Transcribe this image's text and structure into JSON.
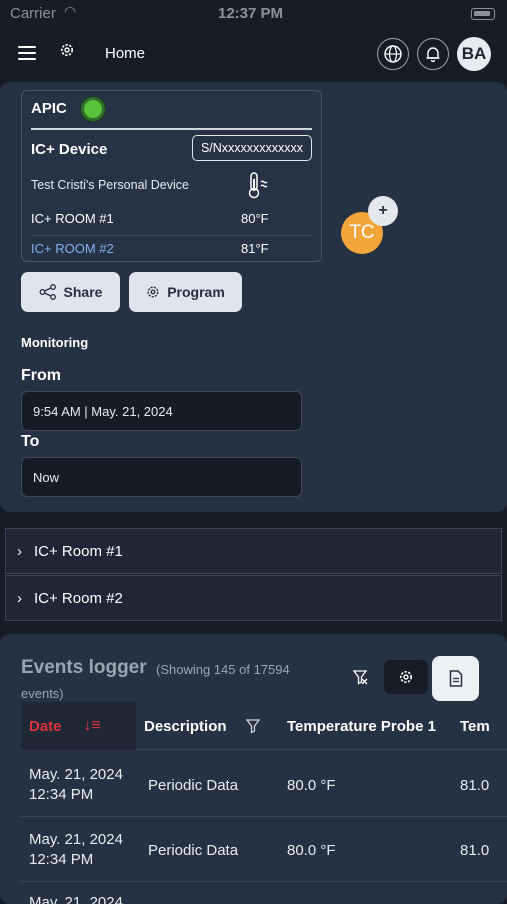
{
  "status_bar": {
    "carrier": "Carrier",
    "time": "12:37 PM"
  },
  "header": {
    "home_label": "Home",
    "avatar_initials": "BA"
  },
  "device": {
    "system_label": "APIC",
    "status_color": "#58c13a",
    "title": "IC+ Device",
    "serial": "S/Nxxxxxxxxxxxxx",
    "name": "Test Cristi's Personal Device",
    "rooms": [
      {
        "name": "IC+ ROOM #1",
        "temp": "80°F"
      },
      {
        "name": "IC+ ROOM #2",
        "temp": "81°F"
      }
    ]
  },
  "assignee": {
    "initials": "TC",
    "add_symbol": "+"
  },
  "actions": {
    "share_label": "Share",
    "program_label": "Program"
  },
  "monitoring": {
    "section_label": "Monitoring",
    "from_label": "From",
    "from_value": "9:54 AM | May. 21, 2024",
    "to_label": "To",
    "to_value": "Now"
  },
  "room_sections": [
    {
      "label": "IC+ Room #1"
    },
    {
      "label": "IC+ Room #2"
    }
  ],
  "events": {
    "title": "Events logger",
    "showing_prefix": "(Showing 145 of 17594",
    "showing_suffix": "events)",
    "columns": {
      "date": "Date",
      "description": "Description",
      "probe1": "Temperature Probe 1",
      "probe2": "Tem"
    },
    "rows": [
      {
        "date": "May. 21, 2024",
        "time": "12:34 PM",
        "description": "Periodic Data",
        "probe1": "80.0 °F",
        "probe2": "81.0"
      },
      {
        "date": "May. 21, 2024",
        "time": "12:34 PM",
        "description": "Periodic Data",
        "probe1": "80.0 °F",
        "probe2": "81.0"
      },
      {
        "date": "May. 21, 2024",
        "time": "",
        "description": "",
        "probe1": "",
        "probe2": ""
      }
    ]
  },
  "colors": {
    "accent_red": "#e0323c",
    "accent_blue": "#7fb2f0",
    "status_green": "#58c13a"
  }
}
